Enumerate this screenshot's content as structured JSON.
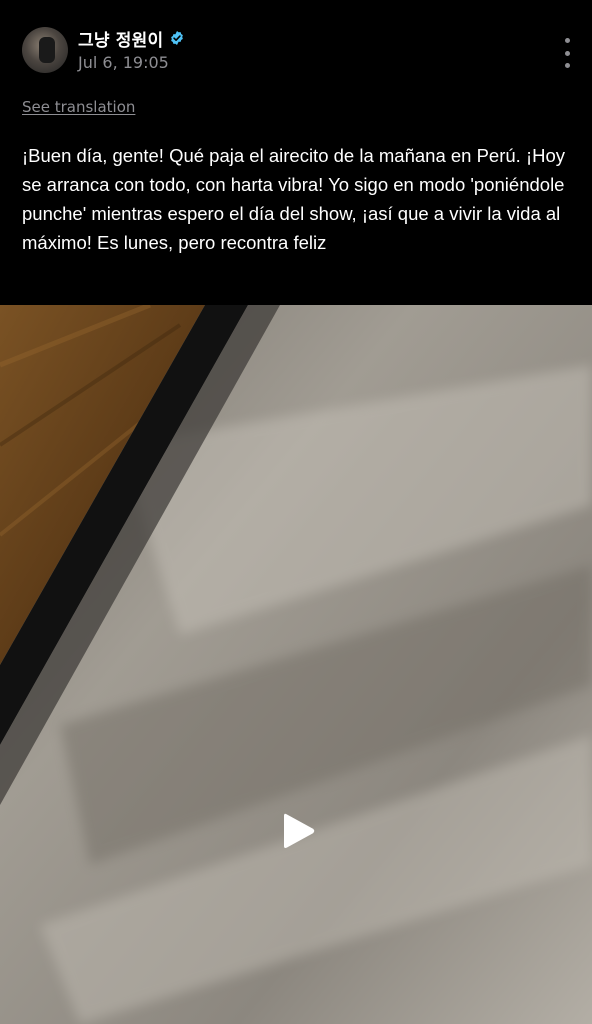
{
  "post": {
    "author": {
      "name": "그냥 정원이",
      "verified": true,
      "verified_color": "#4fc3f7"
    },
    "timestamp": "Jul 6, 19:05",
    "see_translation_label": "See translation",
    "text": "¡Buen día, gente! Qué paja el airecito de la mañana en Perú. ¡Hoy se arranca con todo, con harta vibra! Yo sigo en modo 'poniéndole punche' mientras espero el día del show, ¡así que a vivir la vida al máximo! Es lunes, pero recontra feliz",
    "icons": {
      "more": "more-vertical-icon",
      "verified": "verified-badge-icon",
      "play": "play-icon"
    }
  },
  "colors": {
    "background": "#000000",
    "secondary_text": "#8e8e93",
    "primary_text": "#ffffff"
  }
}
